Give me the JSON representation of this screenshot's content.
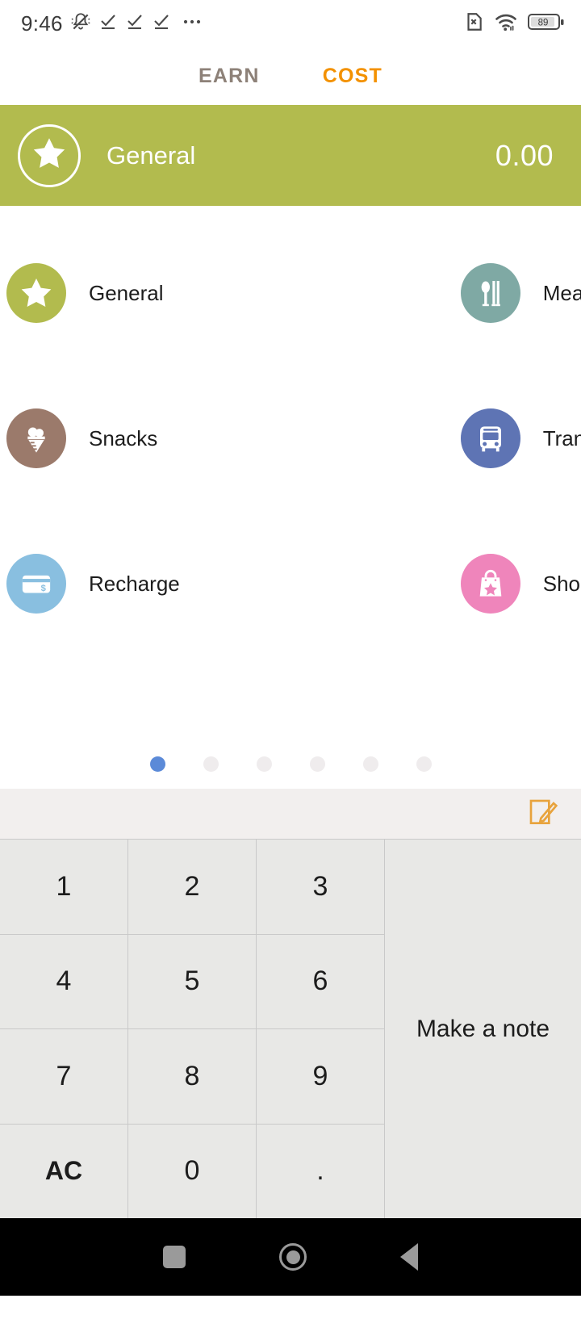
{
  "status_bar": {
    "time": "9:46",
    "left_icons": [
      "bell-muted-icon",
      "check-underline-icon",
      "check-underline-icon",
      "check-underline-icon",
      "ellipsis-icon"
    ],
    "right_icons": [
      "sim-card-missing-icon",
      "wifi-icon",
      "battery-icon"
    ],
    "battery_level": "89"
  },
  "tabs": {
    "earn_label": "EARN",
    "cost_label": "COST",
    "active": "COST",
    "earn_color": "#8d8178",
    "cost_color": "#f39100"
  },
  "selected_category": {
    "icon": "star-icon",
    "name": "General",
    "amount": "0.00",
    "background_color": "#b2bb4e"
  },
  "categories": [
    {
      "label": "General",
      "icon": "star-icon",
      "color": "#b2bb4e"
    },
    {
      "label": "Meals",
      "icon": "cutlery-icon",
      "color": "#7fa9a4"
    },
    {
      "label": "Snacks",
      "icon": "ice-cream-icon",
      "color": "#9b7a6b"
    },
    {
      "label": "Transportation",
      "icon": "bus-icon",
      "color": "#5e74b4"
    },
    {
      "label": "Recharge",
      "icon": "credit-card-icon",
      "color": "#89bfe0"
    },
    {
      "label": "Shopping",
      "icon": "shopping-bag-icon",
      "color": "#ef85bb"
    }
  ],
  "pagination": {
    "total": 6,
    "active_index": 0,
    "active_color": "#5b8ad8",
    "inactive_color": "#efeced"
  },
  "note_bar": {
    "edit_icon": "note-edit-icon",
    "icon_color": "#e8a33d"
  },
  "keypad": {
    "keys": [
      "1",
      "2",
      "3",
      "4",
      "5",
      "6",
      "7",
      "8",
      "9",
      "AC",
      "0",
      "."
    ],
    "note_button_label": "Make a note"
  },
  "nav_bar": {
    "buttons": [
      "recents-square-icon",
      "home-circle-icon",
      "back-triangle-icon"
    ]
  }
}
